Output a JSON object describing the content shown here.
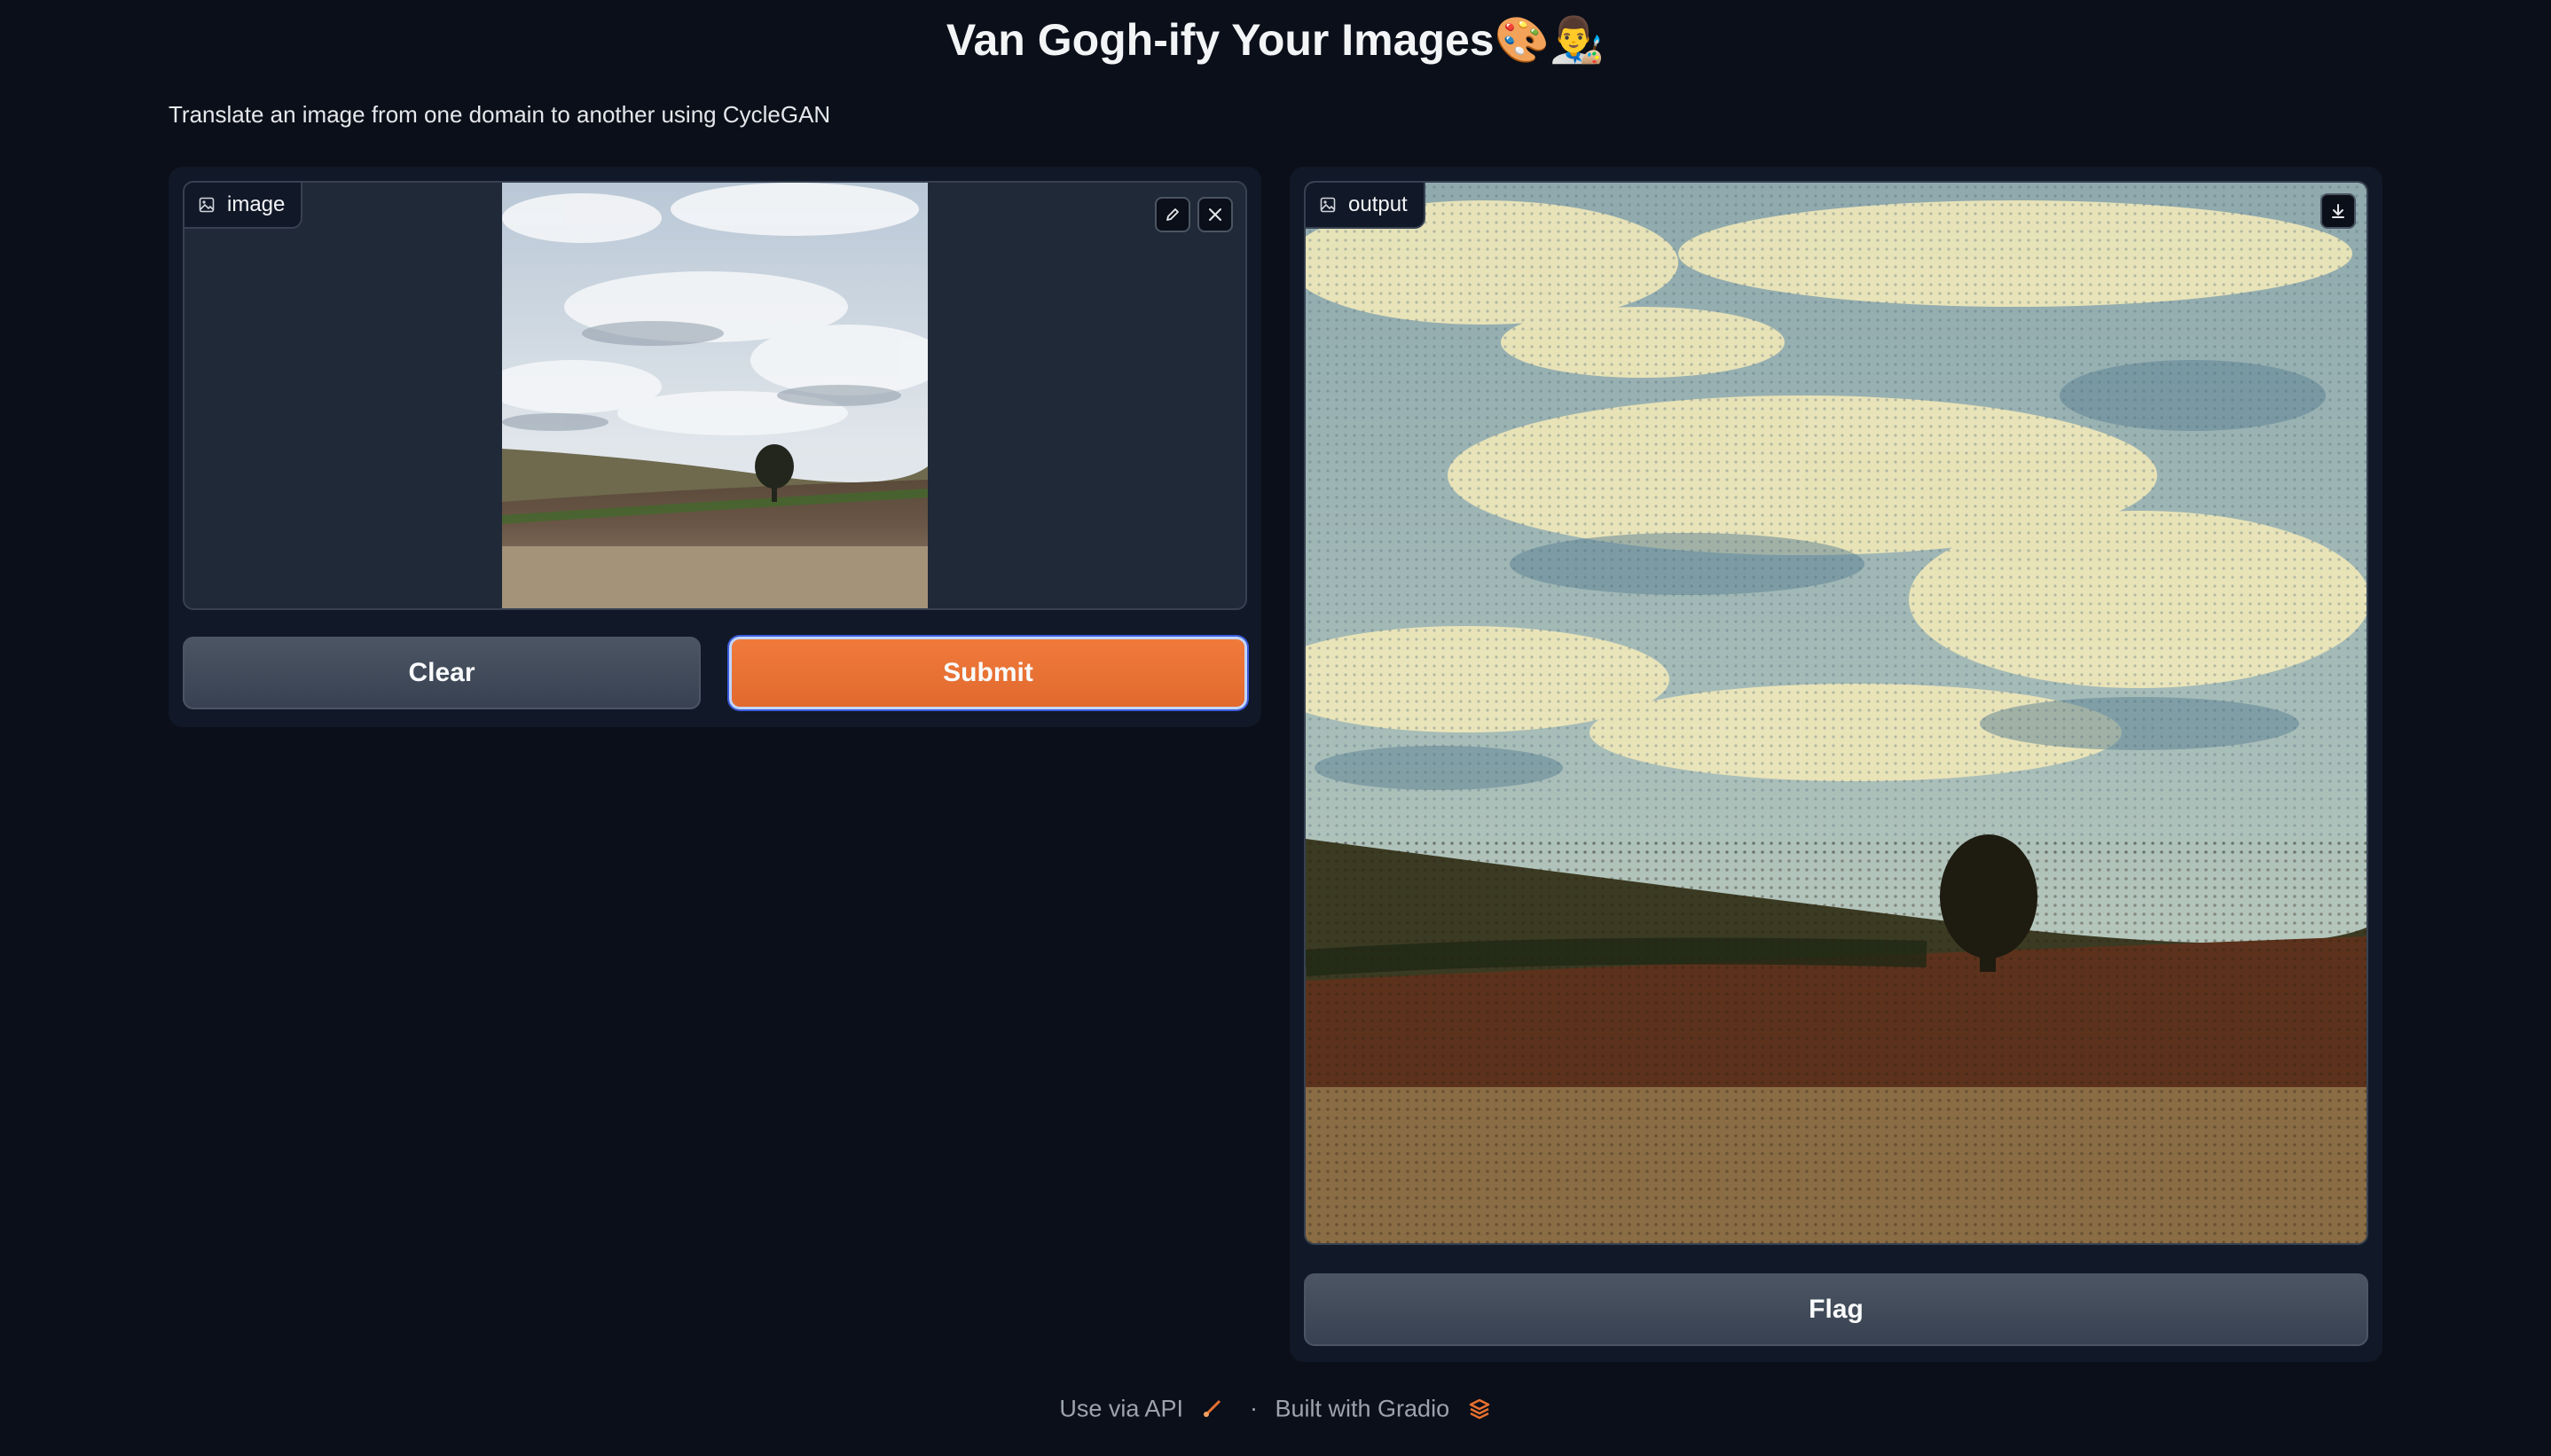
{
  "header": {
    "title": "Van Gogh-ify Your Images",
    "title_emoji": "🎨👨‍🎨",
    "description": "Translate an image from one domain to another using CycleGAN"
  },
  "input": {
    "label": "image",
    "edit_icon": "pencil-icon",
    "close_icon": "close-icon",
    "label_icon": "image-icon"
  },
  "output": {
    "label": "output",
    "label_icon": "image-icon",
    "download_icon": "download-icon"
  },
  "buttons": {
    "clear": "Clear",
    "submit": "Submit",
    "flag": "Flag"
  },
  "footer": {
    "api_link": "Use via API",
    "separator": "·",
    "built_with": "Built with Gradio"
  },
  "colors": {
    "background": "#0b0f19",
    "panel": "#111827",
    "primary": "#e8702f",
    "secondary": "#4b5563"
  }
}
